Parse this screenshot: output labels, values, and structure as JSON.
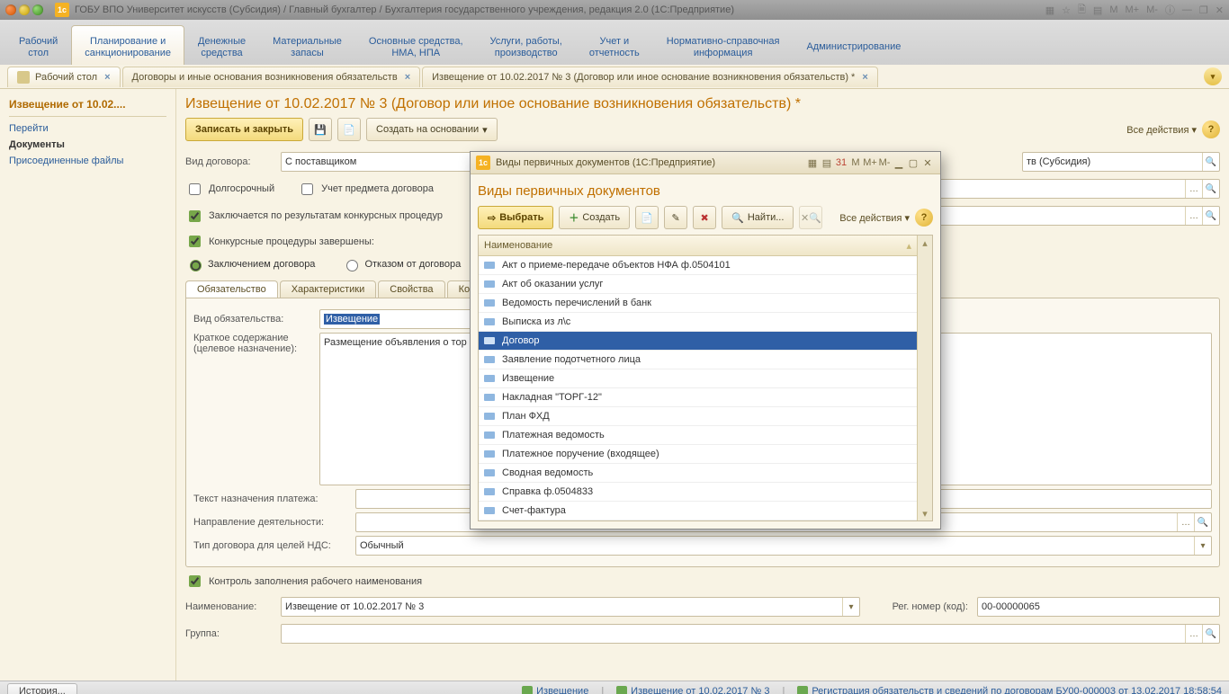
{
  "window": {
    "title": "ГОБУ ВПО Университет искусств (Субсидия) / Главный бухгалтер / Бухгалтерия государственного учреждения, редакция 2.0  (1С:Предприятие)",
    "logo": "1с",
    "right_items": [
      "M",
      "M+",
      "M-"
    ]
  },
  "sections": [
    "Рабочий\nстол",
    "Планирование и\nсанкционирование",
    "Денежные\nсредства",
    "Материальные\nзапасы",
    "Основные средства,\nНМА, НПА",
    "Услуги, работы,\nпроизводство",
    "Учет и\nотчетность",
    "Нормативно-справочная\nинформация",
    "Администрирование"
  ],
  "sections_active_index": 1,
  "open_tabs": [
    {
      "label": "Рабочий стол",
      "closable": true,
      "has_icon": true
    },
    {
      "label": "Договоры и иные основания возникновения обязательств",
      "closable": true
    },
    {
      "label": "Извещение от 10.02.2017 № 3 (Договор или иное основание возникновения обязательств) *",
      "closable": true
    }
  ],
  "leftnav": {
    "header": "Извещение от 10.02....",
    "links": [
      {
        "label": "Перейти",
        "bold": false
      },
      {
        "label": "Документы",
        "bold": true
      },
      {
        "label": "Присоединенные файлы",
        "bold": false
      }
    ]
  },
  "form": {
    "title": "Извещение от 10.02.2017 № 3 (Договор или иное основание возникновения обязательств) *",
    "toolbar": {
      "save_close": "Записать и закрыть",
      "create_based": "Создать на основании",
      "all_actions": "Все действия"
    },
    "vid_dogovora_label": "Вид договора:",
    "vid_dogovora_value": "С поставщиком",
    "org_suffix_value": "тв (Субсидия)",
    "check_longterm": "Долгосрочный",
    "check_uchet": "Учет предмета договора",
    "check_konkurs": "Заключается по результатам конкурсных процедур",
    "check_konkurs_done": "Конкурсные процедуры завершены:",
    "radio_conclusion": "Заключением договора",
    "radio_refusal": "Отказом от договора",
    "sub_tabs": [
      "Обязательство",
      "Характеристики",
      "Свойства",
      "Ко"
    ],
    "vid_ob_label": "Вид обязательства:",
    "vid_ob_value": "Извещение",
    "kratkoe_label1": "Краткое содержание",
    "kratkoe_label2": "(целевое назначение):",
    "kratkoe_value": "Размещение объявления о тор",
    "text_nazn_label": "Текст назначения платежа:",
    "napr_label": "Направление деятельности:",
    "tip_nds_label": "Тип договора для целей НДС:",
    "tip_nds_value": "Обычный",
    "check_control": "Контроль заполнения рабочего наименования",
    "naimen_label": "Наименование:",
    "naimen_value": "Извещение от 10.02.2017 № 3",
    "reg_label": "Рег. номер (код):",
    "reg_value": "00-00000065",
    "group_label": "Группа:"
  },
  "modal": {
    "title": "Виды первичных документов  (1С:Предприятие)",
    "heading": "Виды первичных документов",
    "toolbar": {
      "select": "Выбрать",
      "create": "Создать",
      "find": "Найти...",
      "all_actions": "Все действия"
    },
    "column_header": "Наименование",
    "items": [
      "Акт о приеме-передаче объектов НФА ф.0504101",
      "Акт об оказании услуг",
      "Ведомость перечислений в банк",
      "Выписка из л\\с",
      "Договор",
      "Заявление подотчетного лица",
      "Извещение",
      "Накладная \"ТОРГ-12\"",
      "План ФХД",
      "Платежная ведомость",
      "Платежное поручение (входящее)",
      "Сводная ведомость",
      "Справка ф.0504833",
      "Счет-фактура"
    ],
    "selected_index": 4,
    "right_marks": [
      "M",
      "M+",
      "M-"
    ]
  },
  "status": {
    "history": "История...",
    "items": [
      "Извещение",
      "Извещение от 10.02.2017 № 3",
      "Регистрация обязательств и сведений по договорам БУ00-000003 от 13.02.2017 18:58:54"
    ]
  }
}
